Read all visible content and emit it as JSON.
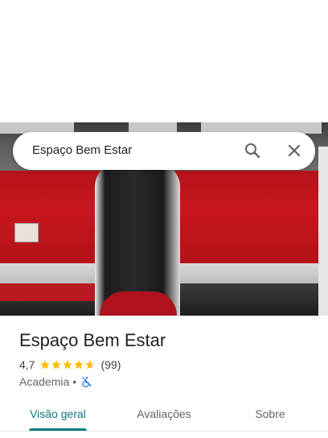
{
  "search": {
    "query": "Espaço Bem Estar"
  },
  "place": {
    "name": "Espaço Bem Estar",
    "rating": "4,7",
    "rating_value": 4.7,
    "review_count": "(99)",
    "category": "Academia",
    "separator": "•",
    "accessibility_icon": "wheelchair-not-accessible-icon"
  },
  "tabs": [
    {
      "label": "Visão geral",
      "active": true
    },
    {
      "label": "Avaliações",
      "active": false
    },
    {
      "label": "Sobre",
      "active": false
    }
  ],
  "colors": {
    "accent": "#0b7a7f",
    "star": "#fbbc04",
    "access_icon": "#1a73e8"
  }
}
